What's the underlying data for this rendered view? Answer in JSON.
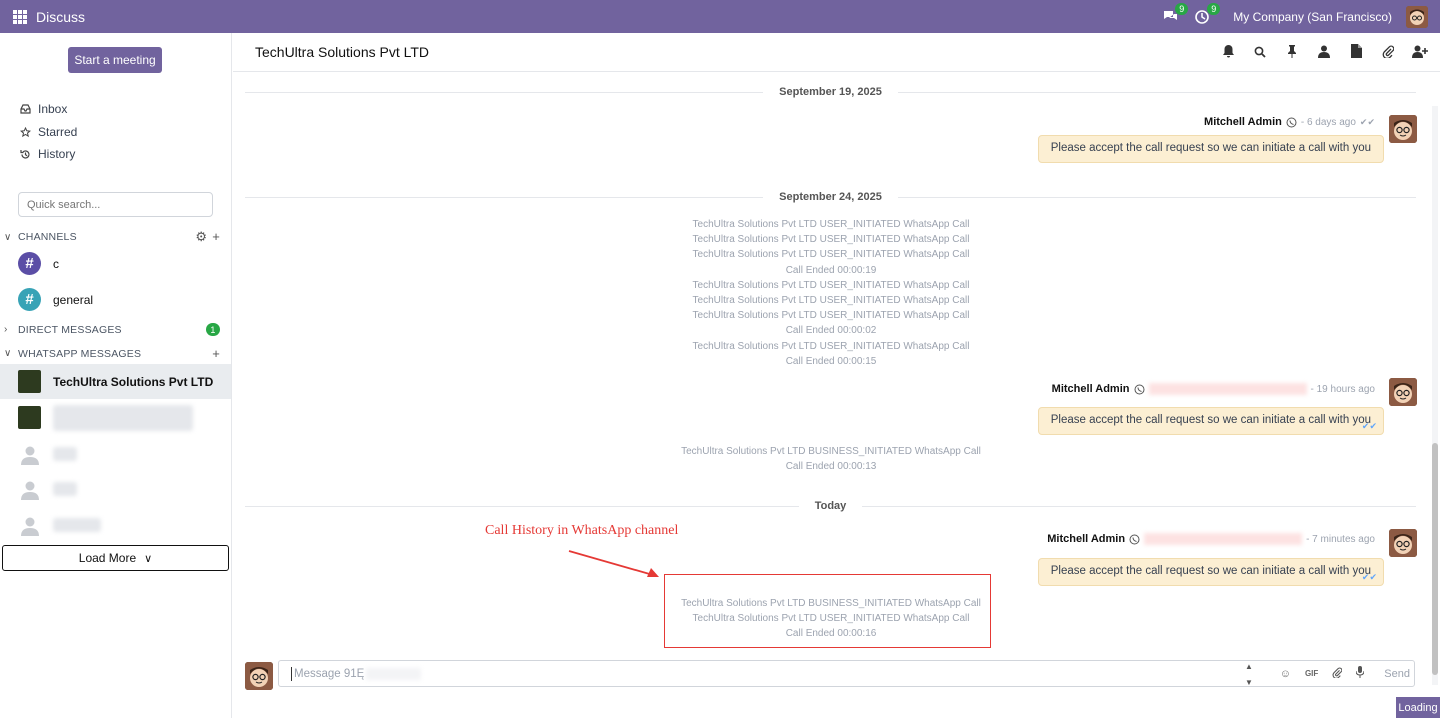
{
  "topbar": {
    "app_title": "Discuss",
    "messages_count": "9",
    "activities_count": "9",
    "company": "My Company (San Francisco)"
  },
  "sidebar": {
    "start_meeting": "Start a meeting",
    "nav": [
      {
        "label": "Inbox",
        "icon": "inbox-icon"
      },
      {
        "label": "Starred",
        "icon": "star-icon"
      },
      {
        "label": "History",
        "icon": "history-icon"
      }
    ],
    "search_placeholder": "Quick search...",
    "channels_heading": "CHANNELS",
    "channels": [
      {
        "name": "c",
        "color": "#5b4ea6"
      },
      {
        "name": "general",
        "color": "#38a3b6"
      }
    ],
    "direct_heading": "DIRECT MESSAGES",
    "direct_count": "1",
    "whatsapp_heading": "WHATSAPP MESSAGES",
    "whatsapp_active": "TechUltra Solutions Pvt LTD",
    "load_more": "Load More"
  },
  "thread": {
    "title": "TechUltra Solutions Pvt LTD",
    "date1": "September 19, 2025",
    "date2": "September 24, 2025",
    "date3": "Today",
    "msg1_author": "Mitchell Admin",
    "msg1_time": "- 6 days ago",
    "msg1_text": "Please accept the call request so we can initiate a call with you",
    "sys1": [
      "TechUltra Solutions Pvt LTD USER_INITIATED WhatsApp Call",
      "TechUltra Solutions Pvt LTD USER_INITIATED WhatsApp Call",
      "TechUltra Solutions Pvt LTD USER_INITIATED WhatsApp Call",
      "Call Ended 00:00:19",
      "TechUltra Solutions Pvt LTD USER_INITIATED WhatsApp Call",
      "TechUltra Solutions Pvt LTD USER_INITIATED WhatsApp Call",
      "TechUltra Solutions Pvt LTD USER_INITIATED WhatsApp Call",
      "Call Ended 00:00:02",
      "TechUltra Solutions Pvt LTD USER_INITIATED WhatsApp Call",
      "Call Ended 00:00:15"
    ],
    "msg2_author": "Mitchell Admin",
    "msg2_time": "- 19 hours ago",
    "msg2_text": "Please accept the call request so we can initiate a call with you",
    "sys2": [
      "TechUltra Solutions Pvt LTD BUSINESS_INITIATED WhatsApp Call",
      "Call Ended 00:00:13"
    ],
    "msg3_author": "Mitchell Admin",
    "msg3_time": "- 7 minutes ago",
    "msg3_text": "Please accept the call request so we can initiate a call with you",
    "annotation": "Call History in WhatsApp channel",
    "sys3": [
      "TechUltra Solutions Pvt LTD BUSINESS_INITIATED WhatsApp Call",
      "TechUltra Solutions Pvt LTD USER_INITIATED WhatsApp Call",
      "Call Ended 00:00:16"
    ]
  },
  "composer": {
    "placeholder": "Message 91Ę",
    "send": "Send",
    "gif": "GIF"
  },
  "status": {
    "loading": "Loading"
  }
}
